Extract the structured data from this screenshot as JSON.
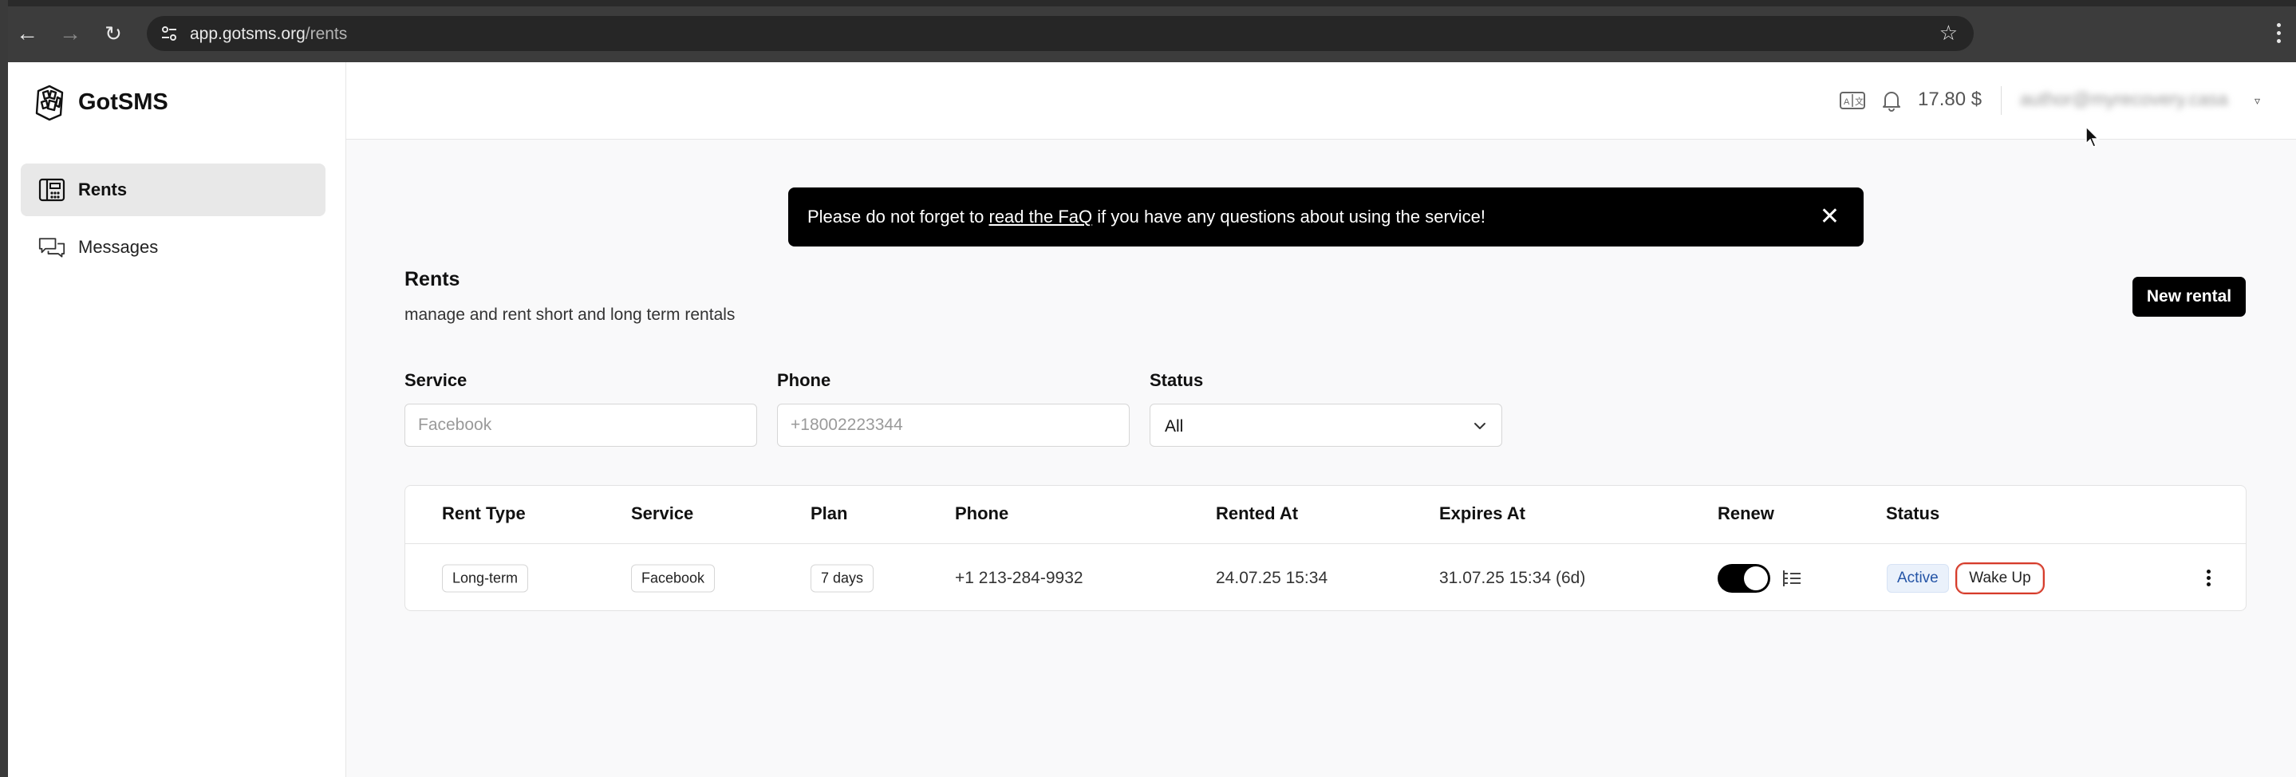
{
  "browser": {
    "url_host": "app.gotsms.org",
    "url_path": "/rents"
  },
  "brand": {
    "name": "GotSMS"
  },
  "sidebar": {
    "items": [
      {
        "label": "Rents",
        "active": true
      },
      {
        "label": "Messages",
        "active": false
      }
    ]
  },
  "topbar": {
    "balance": "17.80 $",
    "user_email": "author@myrecovery.casa"
  },
  "banner": {
    "text_before": "Please do not forget to ",
    "link_text": "read the FaQ",
    "text_after": " if you have any questions about using the service!"
  },
  "page": {
    "title": "Rents",
    "subtitle": "manage and rent short and long term rentals",
    "new_button": "New rental"
  },
  "filters": {
    "service": {
      "label": "Service",
      "placeholder": "Facebook"
    },
    "phone": {
      "label": "Phone",
      "placeholder": "+18002223344"
    },
    "status": {
      "label": "Status",
      "value": "All"
    }
  },
  "table": {
    "headers": [
      "Rent Type",
      "Service",
      "Plan",
      "Phone",
      "Rented At",
      "Expires At",
      "Renew",
      "Status"
    ],
    "rows": [
      {
        "rent_type": "Long-term",
        "service": "Facebook",
        "plan": "7 days",
        "phone": "+1 213-284-9932",
        "rented_at": "24.07.25 15:34",
        "expires_at": "31.07.25 15:34 (6d)",
        "renew": true,
        "status": "Active",
        "action": "Wake Up"
      }
    ]
  },
  "colors": {
    "accent": "#000000",
    "active_badge_bg": "#eaf1fb",
    "active_badge_text": "#2454a6",
    "wake_up_outline": "#d63b2a"
  }
}
